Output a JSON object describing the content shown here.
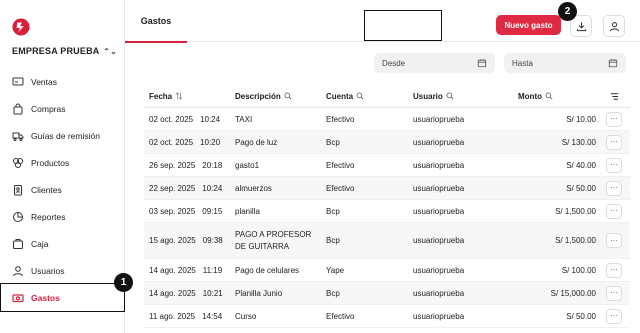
{
  "brand": {
    "accent": "#d8203c",
    "company": "EMPRESA PRUEBA"
  },
  "sidebar": {
    "items": [
      {
        "label": "Ventas",
        "icon": "monitor-icon",
        "active": false
      },
      {
        "label": "Compras",
        "icon": "bag-icon",
        "active": false
      },
      {
        "label": "Guías de remisión",
        "icon": "truck-icon",
        "active": false
      },
      {
        "label": "Productos",
        "icon": "boxes-icon",
        "active": false
      },
      {
        "label": "Clientes",
        "icon": "clipboard-user-icon",
        "active": false
      },
      {
        "label": "Reportes",
        "icon": "pie-chart-icon",
        "active": false
      },
      {
        "label": "Caja",
        "icon": "cash-box-icon",
        "active": false
      },
      {
        "label": "Usuarios",
        "icon": "user-icon",
        "active": false
      },
      {
        "label": "Gastos",
        "icon": "money-icon",
        "active": true
      }
    ]
  },
  "header": {
    "tab": "Gastos",
    "new_button": "Nuevo gasto"
  },
  "annotations": {
    "badge1": "1",
    "badge2": "2"
  },
  "filters": {
    "desde": "Desde",
    "hasta": "Hasta"
  },
  "table": {
    "headers": {
      "fecha": "Fecha",
      "descripcion": "Descripción",
      "cuenta": "Cuenta",
      "usuario": "Usuario",
      "monto": "Monto"
    },
    "rows": [
      {
        "date": "02 oct. 2025",
        "time": "10:24",
        "desc": "TAXI",
        "cuenta": "Efectivo",
        "usuario": "usuarioprueba",
        "monto": "S/ 10.00"
      },
      {
        "date": "02 oct. 2025",
        "time": "10:20",
        "desc": "Pago de luz",
        "cuenta": "Bcp",
        "usuario": "usuarioprueba",
        "monto": "S/ 130.00"
      },
      {
        "date": "26 sep. 2025",
        "time": "20:18",
        "desc": "gasto1",
        "cuenta": "Efectivo",
        "usuario": "usuarioprueba",
        "monto": "S/ 40.00"
      },
      {
        "date": "22 sep. 2025",
        "time": "10:24",
        "desc": "almuerzos",
        "cuenta": "Efectivo",
        "usuario": "usuarioprueba",
        "monto": "S/ 50.00"
      },
      {
        "date": "03 sep. 2025",
        "time": "09:15",
        "desc": "planilla",
        "cuenta": "Bcp",
        "usuario": "usuarioprueba",
        "monto": "S/ 1,500.00"
      },
      {
        "date": "15 ago. 2025",
        "time": "09:38",
        "desc": "PAGO A PROFESOR DE GUITARRA",
        "cuenta": "Bcp",
        "usuario": "usuarioprueba",
        "monto": "S/ 1,500.00"
      },
      {
        "date": "14 ago. 2025",
        "time": "11:19",
        "desc": "Pago de celulares",
        "cuenta": "Yape",
        "usuario": "usuarioprueba",
        "monto": "S/ 100.00"
      },
      {
        "date": "14 ago. 2025",
        "time": "10:21",
        "desc": "Planilla Junio",
        "cuenta": "Bcp",
        "usuario": "usuarioprueba",
        "monto": "S/ 15,000.00"
      },
      {
        "date": "11 ago. 2025",
        "time": "14:54",
        "desc": "Curso",
        "cuenta": "Efectivo",
        "usuario": "usuarioprueba",
        "monto": "S/ 50.00"
      }
    ]
  }
}
